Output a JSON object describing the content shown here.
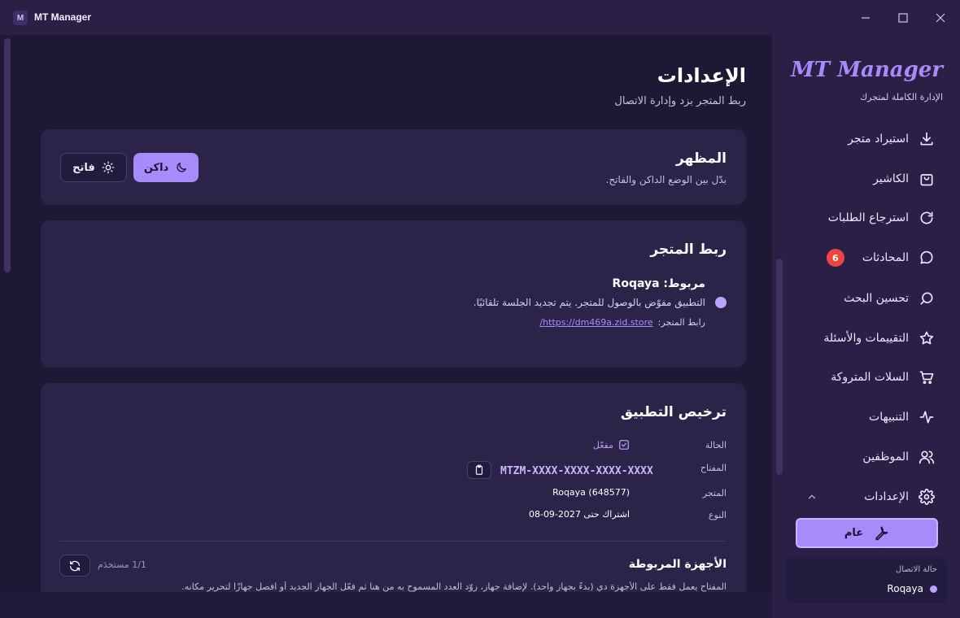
{
  "window": {
    "title": "MT Manager",
    "logo_letter": "M"
  },
  "page": {
    "title": "الإعدادات",
    "subtitle": "ربط المتجر بزد وإدارة الاتصال"
  },
  "appearance": {
    "title": "المظهر",
    "description": "بدّل بين الوضع الداكن والفاتح.",
    "dark_label": "داكن",
    "light_label": "فاتح",
    "selected": "dark"
  },
  "store": {
    "title": "ربط المتجر",
    "status_title": "مربوط: Roqaya",
    "status_desc": "التطبيق مفوّض بالوصول للمتجر. يتم تجديد الجلسة تلقائيًا.",
    "link_label": "رابط المتجر:",
    "link_url": "https://dm469a.zid.store/"
  },
  "license": {
    "title": "ترخيص التطبيق",
    "rows": {
      "status_label": "الحالة",
      "status_value": "مفعّل",
      "key_label": "المفتاح",
      "key_value": "MTZM-XXXX-XXXX-XXXX-XXXX",
      "store_label": "المتجر",
      "store_value": "Roqaya (648577)",
      "type_label": "النوع",
      "type_value": "اشتراك حتى 2027-09-08"
    },
    "devices_title": "الأجهزة المربوطة",
    "devices_count": "1/1 مستخدَم",
    "devices_note": "المفتاح يعمل فقط على الأجهزة دي (بدءً بجهاز واحد). لإضافة جهاز، زوّد العدد المسموح به من هنا ثم فعّل الجهاز الجديد أو افصل جهازًا لتحرير مكانه."
  },
  "sidebar": {
    "brand": "MT Manager",
    "brand_sub": "الإدارة الكاملة لمتجرك",
    "items": [
      {
        "label": "استيراد متجر",
        "icon": "download-icon"
      },
      {
        "label": "الكاشير",
        "icon": "shopping-bag-icon"
      },
      {
        "label": "استرجاع الطلبات",
        "icon": "refresh-icon"
      },
      {
        "label": "المحادثات",
        "icon": "chat-icon",
        "badge": "6"
      },
      {
        "label": "تحسين البحث",
        "icon": "search-circle-icon"
      },
      {
        "label": "التقييمات والأسئلة",
        "icon": "star-icon"
      },
      {
        "label": "السلات المتروكة",
        "icon": "cart-icon"
      },
      {
        "label": "التنبيهات",
        "icon": "activity-icon"
      },
      {
        "label": "الموظفين",
        "icon": "users-icon"
      },
      {
        "label": "الإعدادات",
        "icon": "gear-icon"
      }
    ],
    "sub_item": "عام",
    "connection_label": "حالة الاتصال",
    "connection_store": "Roqaya"
  },
  "colors": {
    "accent": "#a78bfa",
    "badge": "#ef4444",
    "background": "#1f1834",
    "card": "#2c2349"
  }
}
